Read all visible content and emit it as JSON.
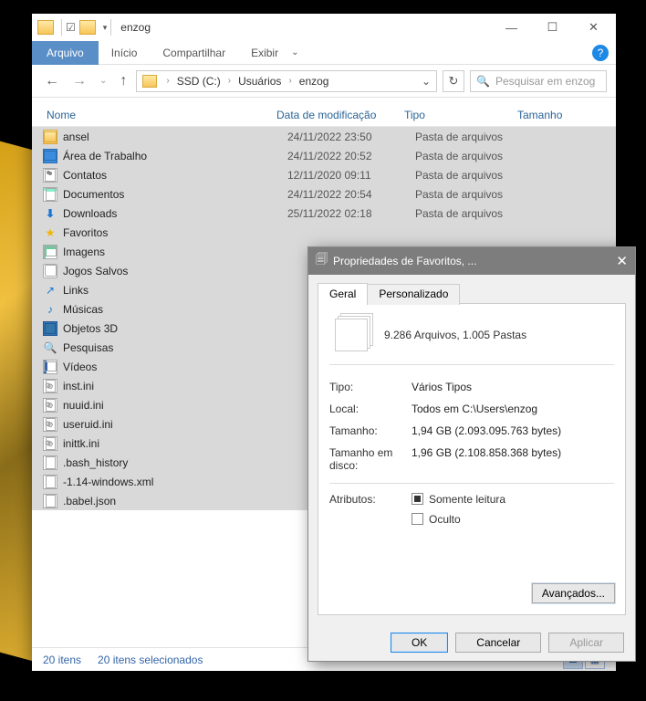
{
  "window": {
    "title": "enzog",
    "ribbon": {
      "file": "Arquivo",
      "home": "Início",
      "share": "Compartilhar",
      "view": "Exibir"
    },
    "breadcrumbs": [
      "SSD (C:)",
      "Usuários",
      "enzog"
    ],
    "search_placeholder": "Pesquisar em enzog",
    "columns": {
      "name": "Nome",
      "date": "Data de modificação",
      "type": "Tipo",
      "size": "Tamanho"
    },
    "status": {
      "items": "20 itens",
      "selected": "20 itens selecionados"
    }
  },
  "files": [
    {
      "icon": "folder",
      "name": "ansel",
      "date": "24/11/2022 23:50",
      "type": "Pasta de arquivos"
    },
    {
      "icon": "desktop",
      "name": "Área de Trabalho",
      "date": "24/11/2022 20:52",
      "type": "Pasta de arquivos"
    },
    {
      "icon": "contacts",
      "name": "Contatos",
      "date": "12/11/2020 09:11",
      "type": "Pasta de arquivos"
    },
    {
      "icon": "docs",
      "name": "Documentos",
      "date": "24/11/2022 20:54",
      "type": "Pasta de arquivos"
    },
    {
      "icon": "dl",
      "name": "Downloads",
      "date": "25/11/2022 02:18",
      "type": "Pasta de arquivos"
    },
    {
      "icon": "star",
      "name": "Favoritos",
      "date": "",
      "type": ""
    },
    {
      "icon": "img",
      "name": "Imagens",
      "date": "",
      "type": ""
    },
    {
      "icon": "games",
      "name": "Jogos Salvos",
      "date": "",
      "type": ""
    },
    {
      "icon": "link",
      "name": "Links",
      "date": "",
      "type": ""
    },
    {
      "icon": "music",
      "name": "Músicas",
      "date": "",
      "type": ""
    },
    {
      "icon": "3d",
      "name": "Objetos 3D",
      "date": "",
      "type": ""
    },
    {
      "icon": "search",
      "name": "Pesquisas",
      "date": "",
      "type": ""
    },
    {
      "icon": "video",
      "name": "Vídeos",
      "date": "",
      "type": ""
    },
    {
      "icon": "ini",
      "name": "inst.ini",
      "date": "",
      "type": ""
    },
    {
      "icon": "ini",
      "name": "nuuid.ini",
      "date": "",
      "type": ""
    },
    {
      "icon": "ini",
      "name": "useruid.ini",
      "date": "",
      "type": ""
    },
    {
      "icon": "ini",
      "name": "inittk.ini",
      "date": "",
      "type": ""
    },
    {
      "icon": "file",
      "name": ".bash_history",
      "date": "",
      "type": ""
    },
    {
      "icon": "file",
      "name": "-1.14-windows.xml",
      "date": "",
      "type": ""
    },
    {
      "icon": "file",
      "name": ".babel.json",
      "date": "",
      "type": ""
    }
  ],
  "dialog": {
    "title": "Propriedades de Favoritos, ...",
    "tabs": {
      "general": "Geral",
      "custom": "Personalizado"
    },
    "summary": "9.286 Arquivos, 1.005 Pastas",
    "rows": {
      "type_l": "Tipo:",
      "type_v": "Vários Tipos",
      "loc_l": "Local:",
      "loc_v": "Todos em C:\\Users\\enzog",
      "size_l": "Tamanho:",
      "size_v": "1,94 GB (2.093.095.763 bytes)",
      "disk_l": "Tamanho em disco:",
      "disk_v": "1,96 GB (2.108.858.368 bytes)",
      "attr_l": "Atributos:"
    },
    "checks": {
      "readonly": "Somente leitura",
      "hidden": "Oculto"
    },
    "buttons": {
      "advanced": "Avançados...",
      "ok": "OK",
      "cancel": "Cancelar",
      "apply": "Aplicar"
    }
  }
}
